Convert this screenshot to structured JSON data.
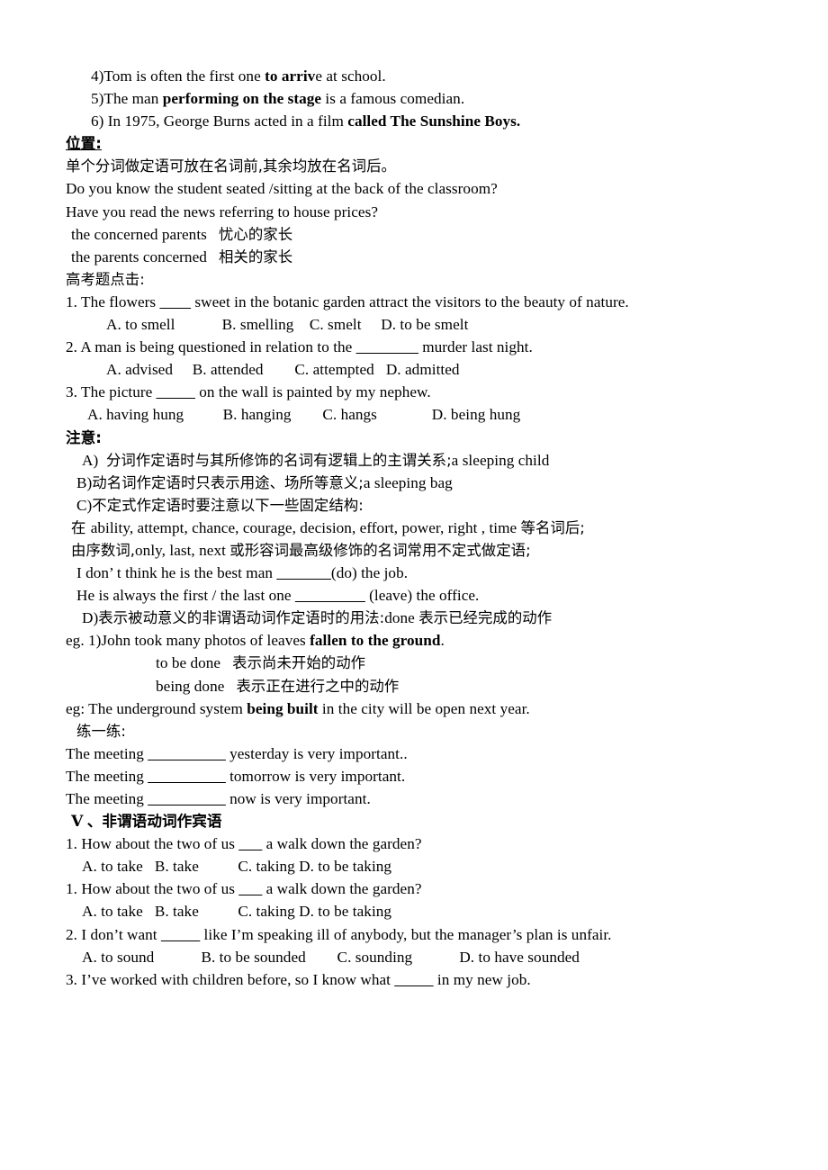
{
  "document": {
    "type": "grammar-worksheet",
    "language": "zh-CN / en",
    "background_color": "#ffffff",
    "text_color": "#000000"
  },
  "examples_top": {
    "items": [
      {
        "num": "4)",
        "pre": "Tom is often the first one ",
        "bold": "to arriv",
        "post": "e at school."
      },
      {
        "num": "5)",
        "pre": "The man ",
        "bold": "performing on the stage",
        "post": " is a famous comedian."
      },
      {
        "num": "6) ",
        "pre": "In 1975, George Burns acted in a film ",
        "bold": "called The Sunshine Boys.",
        "post": ""
      }
    ]
  },
  "position_section": {
    "heading": "位置:",
    "rule": "单个分词做定语可放在名词前,其余均放在名词后。",
    "examples": [
      "Do you know the student seated /sitting at the back of the classroom?",
      "Have you read the news referring to house prices?"
    ],
    "pairs": [
      {
        "en": "the concerned parents",
        "zh": "忧心的家长"
      },
      {
        "en": "the parents concerned",
        "zh": "相关的家长"
      }
    ]
  },
  "gaokao_section": {
    "heading": "高考题点击:",
    "questions": [
      {
        "stem_pre": "1. The flowers ",
        "blank": "____",
        "stem_post": " sweet in the botanic garden attract the visitors to the beauty of nature.",
        "options": [
          "A. to smell",
          "B. smelling",
          "C. smelt",
          "D. to be smelt"
        ]
      },
      {
        "stem_pre": "2. A man is being questioned in relation to the ",
        "blank": "________",
        "stem_post": " murder last night.",
        "options": [
          "A. advised",
          "B. attended",
          "C. attempted",
          "D. admitted"
        ]
      },
      {
        "stem_pre": "3. The picture ",
        "blank": "_____",
        "stem_post": " on the wall is painted by my nephew.",
        "options": [
          "A. having hung",
          "B. hanging",
          "C. hangs",
          "D. being hung"
        ]
      }
    ]
  },
  "notes_section": {
    "heading": "注意:",
    "items": [
      {
        "label": "A)",
        "zh": "分词作定语时与其所修饰的名词有逻辑上的主谓关系;",
        "en": "a sleeping child"
      },
      {
        "label": "B)",
        "zh": "动名词作定语时只表示用途、场所等意义;",
        "en": "a sleeping bag"
      },
      {
        "label": "C)",
        "zh": "不定式作定语时要注意以下一些固定结构:",
        "en": ""
      }
    ],
    "structure_lines": [
      {
        "zh_pre": "在 ",
        "en": "ability, attempt, chance, courage, decision, effort, power, right , time ",
        "zh_post": "等名词后;"
      },
      {
        "zh_pre": "由序数词,",
        "en": "only, last, next ",
        "zh_post": "或形容词最高级修饰的名词常用不定式做定语;"
      }
    ],
    "practice": [
      {
        "pre": "I don’ t think he is the best man ",
        "blank": "_______",
        "post": "(do) the job."
      },
      {
        "pre": "He is always the first / the last one ",
        "blank": "_________",
        "post": " (leave) the office."
      }
    ],
    "item_d": {
      "label": "D)",
      "zh": "表示被动意义的非谓语动词作定语时的用法:",
      "en": "done",
      "zh_tail": "表示已经完成的动作"
    },
    "eg_fallen": {
      "pre": "eg. 1)John took many photos of leaves ",
      "bold": "fallen to the ground",
      "post": "."
    },
    "forms": [
      {
        "en": "to be done",
        "zh": "表示尚未开始的动作"
      },
      {
        "en": "being done",
        "zh": "表示正在进行之中的动作"
      }
    ],
    "eg_being_built": {
      "pre": "eg: The underground system ",
      "bold": "being built",
      "post": " in the city will be open next year."
    }
  },
  "practice_section": {
    "heading": "练一练:",
    "items": [
      {
        "pre": "The meeting ",
        "blank": "__________",
        "post": " yesterday is very important.."
      },
      {
        "pre": "The meeting ",
        "blank": "__________",
        "post": " tomorrow is very important."
      },
      {
        "pre": "The meeting ",
        "blank": "__________",
        "post": " now is very important."
      }
    ]
  },
  "section_five": {
    "numeral": "Ⅴ",
    "heading": "、非谓语动词作宾语",
    "questions": [
      {
        "stem_pre": "1. How about the two of us ",
        "blank": "___",
        "stem_post": " a walk down the garden?",
        "options_line": "A. to take   B. take          C. taking D. to be taking"
      },
      {
        "stem_pre": "1. How about the two of us ",
        "blank": "___",
        "stem_post": " a walk down the garden?",
        "options_line": "A. to take   B. take          C. taking D. to be taking"
      },
      {
        "stem_pre": "2. I don’t want ",
        "blank": "_____",
        "stem_post": " like I’m speaking ill of anybody, but the manager’s plan is unfair.",
        "options_line": "A. to sound            B. to be sounded        C. sounding            D. to have sounded"
      },
      {
        "stem_pre": "3. I’ve worked with children before, so I know what ",
        "blank": "_____",
        "stem_post": " in my new job.",
        "options_line": ""
      }
    ]
  }
}
